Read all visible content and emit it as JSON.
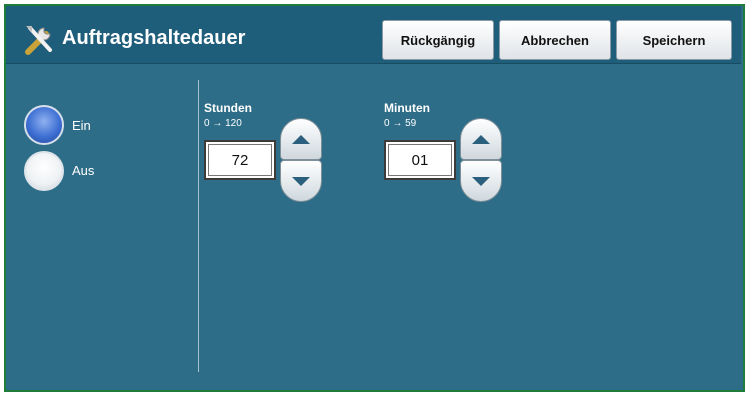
{
  "header": {
    "title": "Auftragshaltedauer",
    "title_icon": "tools-icon",
    "undo_label": "Rückgängig",
    "cancel_label": "Abbrechen",
    "save_label": "Speichern"
  },
  "mode": {
    "options": [
      {
        "label": "Ein",
        "selected": true
      },
      {
        "label": "Aus",
        "selected": false
      }
    ]
  },
  "hours": {
    "label": "Stunden",
    "range": "0 → 120",
    "value": "72"
  },
  "minutes": {
    "label": "Minuten",
    "range": "0 → 59",
    "value": "01"
  },
  "colors": {
    "panel": "#2e6d88",
    "header": "#1f5e7b",
    "border": "#1e7d3a",
    "radio_selected": "#3e6fd3"
  }
}
